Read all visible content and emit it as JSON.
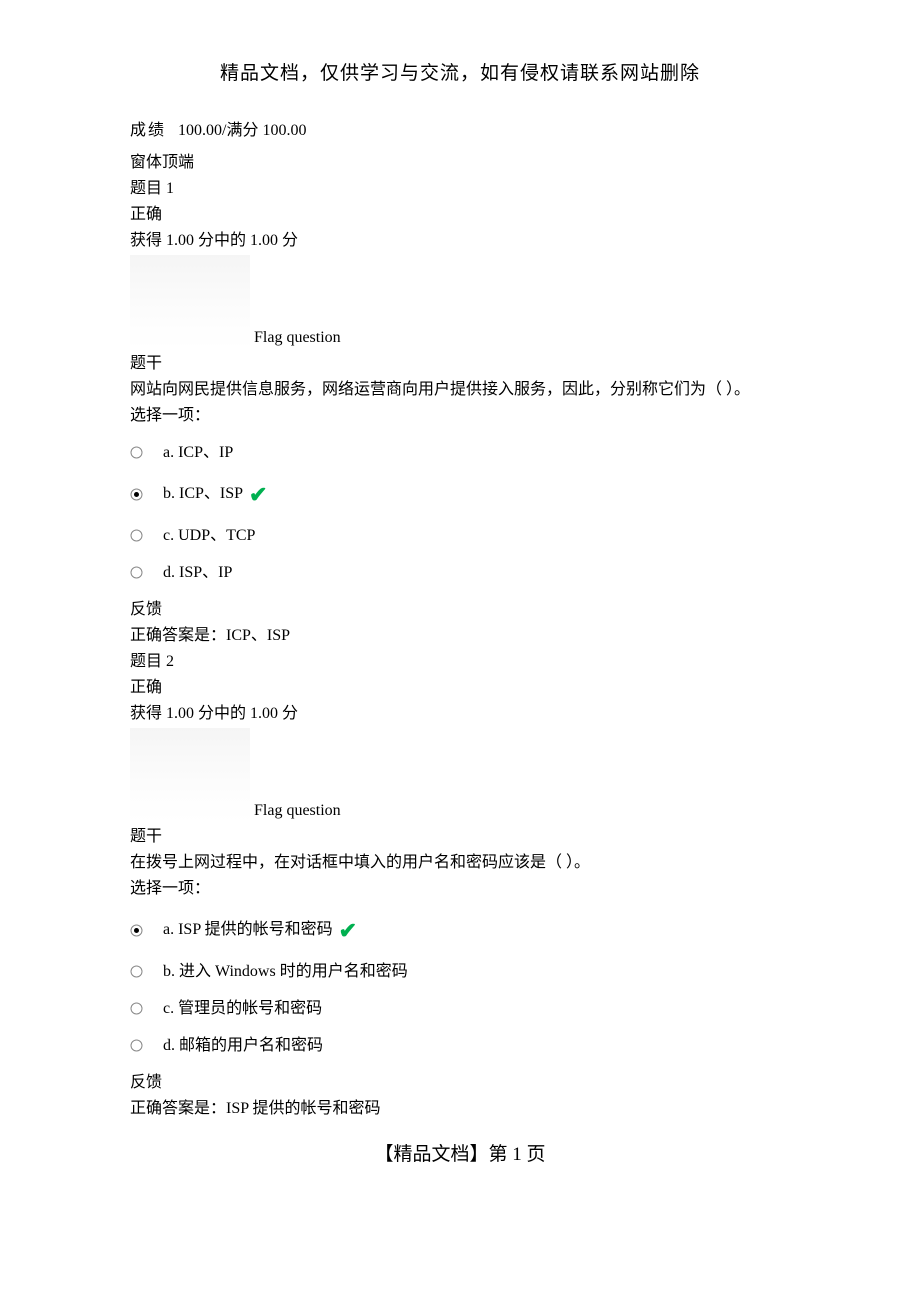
{
  "header_notice": "精品文档，仅供学习与交流，如有侵权请联系网站删除",
  "score_label": "成绩",
  "score_value": "100.00/满分 100.00",
  "window_top": "窗体顶端",
  "flag_question": "Flag question",
  "stem_label": "题干",
  "select_one": "选择一项：",
  "feedback_label": "反馈",
  "correct_answer_prefix": "正确答案是：",
  "questions": [
    {
      "title": "题目 1",
      "status": "正确",
      "points": "获得 1.00 分中的 1.00 分",
      "stem": "网站向网民提供信息服务，网络运营商向用户提供接入服务，因此，分别称它们为（  ）。",
      "options": [
        {
          "label": "a. ICP、IP",
          "selected": false,
          "correct": false
        },
        {
          "label": "b. ICP、ISP",
          "selected": true,
          "correct": true
        },
        {
          "label": "c. UDP、TCP",
          "selected": false,
          "correct": false
        },
        {
          "label": "d. ISP、IP",
          "selected": false,
          "correct": false
        }
      ],
      "correct_answer": "ICP、ISP"
    },
    {
      "title": "题目 2",
      "status": "正确",
      "points": "获得 1.00 分中的 1.00 分",
      "stem": "在拨号上网过程中，在对话框中填入的用户名和密码应该是（  ）。",
      "options": [
        {
          "label": "a. ISP 提供的帐号和密码",
          "selected": true,
          "correct": true
        },
        {
          "label": "b.  进入 Windows 时的用户名和密码",
          "selected": false,
          "correct": false
        },
        {
          "label": "c.  管理员的帐号和密码",
          "selected": false,
          "correct": false
        },
        {
          "label": "d.  邮箱的用户名和密码",
          "selected": false,
          "correct": false
        }
      ],
      "correct_answer": "ISP 提供的帐号和密码"
    }
  ],
  "footer": "【精品文档】第  1  页"
}
